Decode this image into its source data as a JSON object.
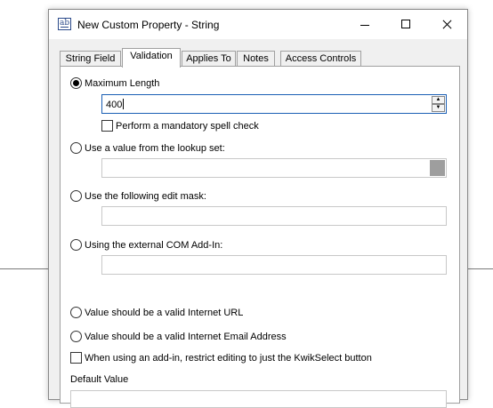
{
  "window": {
    "title": "New Custom Property - String",
    "app_icon_text": "ab"
  },
  "tabs": [
    {
      "label": "String Field",
      "active": false
    },
    {
      "label": "Validation",
      "active": true
    },
    {
      "label": "Applies To",
      "active": false
    },
    {
      "label": "Notes",
      "active": false
    },
    {
      "label": "Access Controls",
      "active": false
    }
  ],
  "validation": {
    "max_length": {
      "label": "Maximum Length",
      "selected": true,
      "value": "400"
    },
    "spell_check": {
      "label": "Perform a mandatory spell check",
      "checked": false
    },
    "lookup_set": {
      "label": "Use a value from the lookup set:",
      "selected": false,
      "value": ""
    },
    "edit_mask": {
      "label": "Use the following edit mask:",
      "selected": false,
      "value": ""
    },
    "com_addin": {
      "label": "Using the external COM Add-In:",
      "selected": false,
      "value": ""
    },
    "internet_url": {
      "label": "Value should be a valid Internet URL",
      "selected": false
    },
    "email_address": {
      "label": "Value should be a valid Internet Email Address",
      "selected": false
    },
    "kwikselect": {
      "label": "When using an add-in, restrict editing to just the KwikSelect button",
      "checked": false
    },
    "default_value": {
      "label": "Default Value"
    }
  },
  "icons": {
    "app": "string-property-icon",
    "minimize": "minimize-icon",
    "maximize": "maximize-icon",
    "close": "close-icon",
    "spin_up": "spin-up-arrow-icon",
    "spin_down": "spin-down-arrow-icon",
    "dropdown": "dropdown-button-icon"
  },
  "colors": {
    "focus_border": "#1a5fb4",
    "dialog_background": "#f0f0f0",
    "panel_background": "#ffffff"
  }
}
